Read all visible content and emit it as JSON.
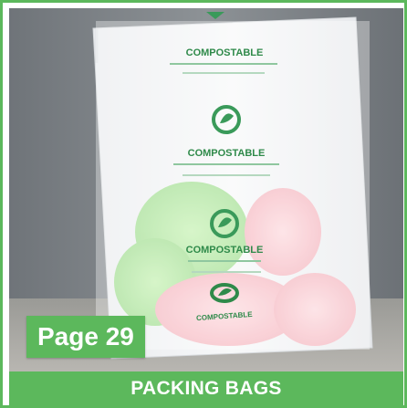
{
  "photo": {
    "bag_print": {
      "brand_label_top": "COMPOSTABLE",
      "brand_label_middle": "COMPOSTABLE",
      "brand_label_lower": "COMPOSTABLE",
      "brand_label_bottom": "COMPOSTABLE"
    }
  },
  "badge": {
    "page_label": "Page 29"
  },
  "footer": {
    "title": "PACKING BAGS"
  },
  "colors": {
    "accent_green": "#5cb85c",
    "print_green": "#2f8a4a"
  }
}
